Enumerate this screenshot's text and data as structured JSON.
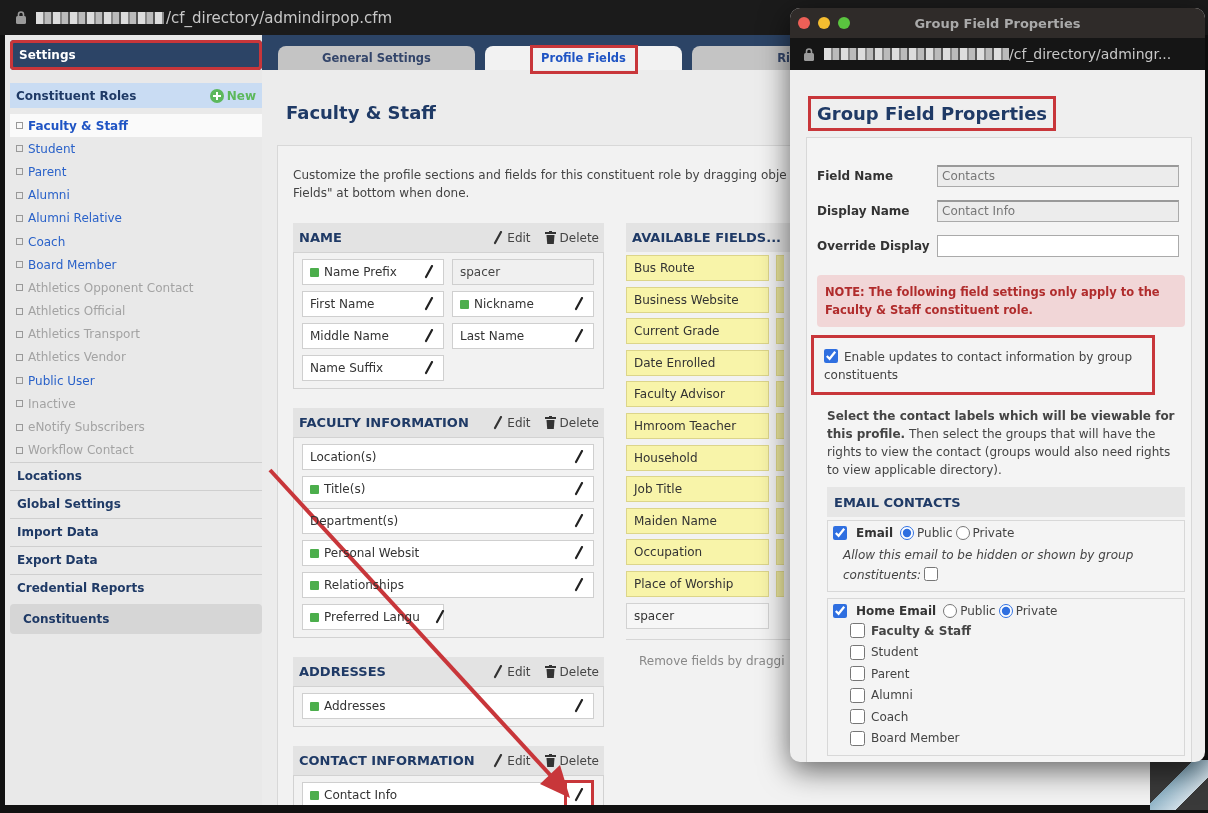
{
  "browser": {
    "url": "/cf_directory/admindirpop.cfm"
  },
  "sidebar": {
    "header": {
      "label": "Settings",
      "highlighted": true
    },
    "roles_header": {
      "label": "Constituent Roles",
      "new_label": "New"
    },
    "roles": [
      {
        "label": "Faculty & Staff",
        "selected": true,
        "disabled": false
      },
      {
        "label": "Student",
        "selected": false,
        "disabled": false
      },
      {
        "label": "Parent",
        "selected": false,
        "disabled": false
      },
      {
        "label": "Alumni",
        "selected": false,
        "disabled": false
      },
      {
        "label": "Alumni Relative",
        "selected": false,
        "disabled": false
      },
      {
        "label": "Coach",
        "selected": false,
        "disabled": false
      },
      {
        "label": "Board Member",
        "selected": false,
        "disabled": false
      },
      {
        "label": "Athletics Opponent Contact",
        "selected": false,
        "disabled": true
      },
      {
        "label": "Athletics Official",
        "selected": false,
        "disabled": true
      },
      {
        "label": "Athletics Transport",
        "selected": false,
        "disabled": true
      },
      {
        "label": "Athletics Vendor",
        "selected": false,
        "disabled": true
      },
      {
        "label": "Public User",
        "selected": false,
        "disabled": false
      },
      {
        "label": "Inactive",
        "selected": false,
        "disabled": true
      },
      {
        "label": "eNotify Subscribers",
        "selected": false,
        "disabled": true
      },
      {
        "label": "Workflow Contact",
        "selected": false,
        "disabled": true
      }
    ],
    "sections": [
      {
        "label": "Locations",
        "kind": "link"
      },
      {
        "label": "Global Settings",
        "kind": "link"
      },
      {
        "label": "Import Data",
        "kind": "link"
      },
      {
        "label": "Export Data",
        "kind": "link"
      },
      {
        "label": "Credential Reports",
        "kind": "link"
      },
      {
        "label": "Constituents",
        "kind": "button"
      }
    ]
  },
  "tabs": [
    {
      "label": "General Settings",
      "selected": false,
      "highlighted": false
    },
    {
      "label": "Profile Fields",
      "selected": true,
      "highlighted": true
    },
    {
      "label": "Ri",
      "selected": false,
      "highlighted": false
    }
  ],
  "page": {
    "title": "Faculty & Staff",
    "intro_lines": [
      "Customize the profile sections and fields for this constituent role by dragging obje",
      "Fields\" at bottom when done."
    ],
    "sections": [
      {
        "title": "NAME",
        "edit": "Edit",
        "delete": "Delete",
        "fields": [
          {
            "kind": "field",
            "label": "Name Prefix",
            "active": true,
            "wide": false,
            "highlighted": false
          },
          {
            "kind": "spacer",
            "label": "spacer"
          },
          {
            "kind": "field",
            "label": "First Name",
            "active": false,
            "wide": false,
            "highlighted": false
          },
          {
            "kind": "field",
            "label": "Nickname",
            "active": true,
            "wide": false,
            "highlighted": false
          },
          {
            "kind": "field",
            "label": "Middle Name",
            "active": false,
            "wide": false,
            "highlighted": false
          },
          {
            "kind": "field",
            "label": "Last Name",
            "active": false,
            "wide": false,
            "highlighted": false
          },
          {
            "kind": "field",
            "label": "Name Suffix",
            "active": false,
            "wide": false,
            "highlighted": false
          }
        ]
      },
      {
        "title": "FACULTY INFORMATION",
        "edit": "Edit",
        "delete": "Delete",
        "fields": [
          {
            "kind": "field",
            "label": "Location(s)",
            "active": false,
            "wide": true,
            "highlighted": false
          },
          {
            "kind": "field",
            "label": "Title(s)",
            "active": true,
            "wide": true,
            "highlighted": false
          },
          {
            "kind": "field",
            "label": "Department(s)",
            "active": false,
            "wide": true,
            "highlighted": false
          },
          {
            "kind": "field",
            "label": "Personal Websit",
            "active": true,
            "wide": true,
            "highlighted": false
          },
          {
            "kind": "field",
            "label": "Relationships",
            "active": true,
            "wide": true,
            "highlighted": false
          },
          {
            "kind": "field",
            "label": "Preferred Langu",
            "active": true,
            "wide": false,
            "highlighted": false
          }
        ]
      },
      {
        "title": "ADDRESSES",
        "edit": "Edit",
        "delete": "Delete",
        "fields": [
          {
            "kind": "field",
            "label": "Addresses",
            "active": true,
            "wide": true,
            "highlighted": false
          }
        ]
      },
      {
        "title": "CONTACT INFORMATION",
        "edit": "Edit",
        "delete": "Delete",
        "fields": [
          {
            "kind": "field",
            "label": "Contact Info",
            "active": true,
            "wide": true,
            "highlighted": true
          }
        ]
      }
    ],
    "available": {
      "title": "AVAILABLE FIELDS...",
      "fields": [
        {
          "kind": "field",
          "label": "Bus Route"
        },
        {
          "kind": "field",
          "label": "Business Website"
        },
        {
          "kind": "field",
          "label": "Current Grade"
        },
        {
          "kind": "field",
          "label": "Date Enrolled"
        },
        {
          "kind": "field",
          "label": "Faculty Advisor"
        },
        {
          "kind": "field",
          "label": "Hmroom Teacher"
        },
        {
          "kind": "field",
          "label": "Household"
        },
        {
          "kind": "field",
          "label": "Job Title"
        },
        {
          "kind": "field",
          "label": "Maiden Name"
        },
        {
          "kind": "field",
          "label": "Occupation"
        },
        {
          "kind": "field",
          "label": "Place of Worship"
        },
        {
          "kind": "spacer",
          "label": "spacer"
        }
      ],
      "hint": "Remove fields by draggi"
    }
  },
  "popup": {
    "title": "Group Field Properties",
    "url": "/cf_directory/admingr...",
    "heading": {
      "text": "Group Field Properties",
      "highlighted": true
    },
    "form": [
      {
        "label": "Field Name",
        "value": "Contacts",
        "disabled": true
      },
      {
        "label": "Display Name",
        "value": "Contact Info",
        "disabled": true
      },
      {
        "label": "Override Display",
        "disabled": false
      }
    ],
    "note": "NOTE: The following field settings only apply to the Faculty & Staff constituent role.",
    "enable": {
      "label": "Enable updates to contact information by group constituents",
      "checked": true,
      "highlighted": true
    },
    "instructions": "**Select the contact labels which will be viewable for this profile.** Then select the groups that will have the rights to view the contact (groups would also need rights to view applicable directory).",
    "email_section": {
      "title": "EMAIL CONTACTS",
      "contacts": [
        {
          "label": "Email",
          "checked": true,
          "options": [
            {
              "label": "Public",
              "selected": true
            },
            {
              "label": "Private",
              "selected": false
            }
          ],
          "allow_text": "Allow this email to be hidden or shown by group constituents:",
          "allow_checked": false
        },
        {
          "label": "Home Email",
          "checked": true,
          "options": [
            {
              "label": "Public",
              "selected": false
            },
            {
              "label": "Private",
              "selected": true
            }
          ],
          "groups": [
            {
              "label": "Faculty & Staff",
              "checked": false,
              "current": true
            },
            {
              "label": "Student",
              "checked": false,
              "current": false
            },
            {
              "label": "Parent",
              "checked": false,
              "current": false
            },
            {
              "label": "Alumni",
              "checked": false,
              "current": false
            },
            {
              "label": "Coach",
              "checked": false,
              "current": false
            },
            {
              "label": "Board Member",
              "checked": false,
              "current": false
            }
          ]
        }
      ]
    }
  }
}
